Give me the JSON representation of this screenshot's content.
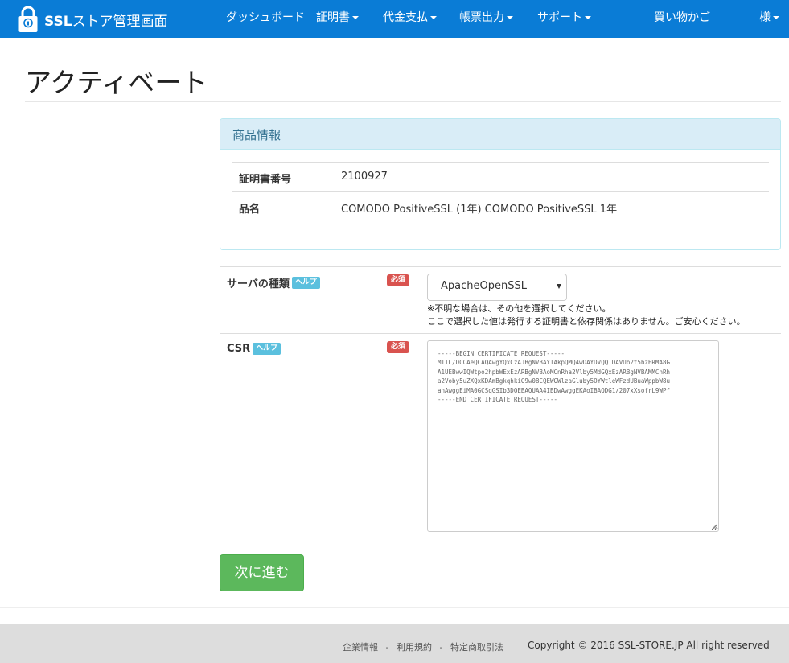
{
  "brand": {
    "bold": "SSL",
    "rest": "ストア管理画面"
  },
  "nav": {
    "dashboard": "ダッシュボード",
    "certificates": "証明書",
    "payment": "代金支払",
    "reports": "帳票出力",
    "support": "サポート",
    "cart": "買い物かご",
    "user": "様"
  },
  "page": {
    "title": "アクティベート"
  },
  "product_panel": {
    "heading": "商品情報",
    "rows": [
      {
        "label": "証明書番号",
        "value": "2100927"
      },
      {
        "label": "品名",
        "value": "COMODO PositiveSSL (1年) COMODO PositiveSSL 1年"
      }
    ]
  },
  "form": {
    "server_type": {
      "label": "サーバの種類",
      "help": "ヘルプ",
      "required": "必須",
      "selected": "ApacheOpenSSL",
      "note1": "※不明な場合は、その他を選択してください。",
      "note2": "ここで選択した値は発行する証明書と依存関係はありません。ご安心ください。"
    },
    "csr": {
      "label": "CSR",
      "help": "ヘルプ",
      "required": "必須",
      "value": "-----BEGIN CERTIFICATE REQUEST-----\nMIIC/DCCAeQCAQAwgYQxCzAJBgNVBAYTAkpQMQ4wDAYDVQQIDAVUb2t5bzERMA8G\nA1UEBwwIQWtpo2hpbWExEzARBgNVBAoMCnRha2Vlby5MdGQxEzARBgNVBAMMCnRh\na2Voby5uZXQxKDAmBgkqhkiG9w0BCQEWGWlzaGluby5OYWtleWFzdUBuaWppbW8u\nanAwggEiMA0GCSqGSIb3DQEBAQUAA4IBDwAwggEKAoIBAQDG1/207xXsofrL9WPf\n-----END CERTIFICATE REQUEST-----"
    },
    "submit": "次に進む"
  },
  "footer": {
    "links": [
      "企業情報",
      "利用規約",
      "特定商取引法"
    ],
    "separator": "-",
    "copyright": "Copyright © 2016 SSL-STORE.JP All right reserved"
  },
  "colors": {
    "navbar": "#0a7cd6",
    "panel_heading": "#d9edf7",
    "help_badge": "#5bc0de",
    "required_badge": "#d9534f",
    "submit": "#5cb85c"
  }
}
